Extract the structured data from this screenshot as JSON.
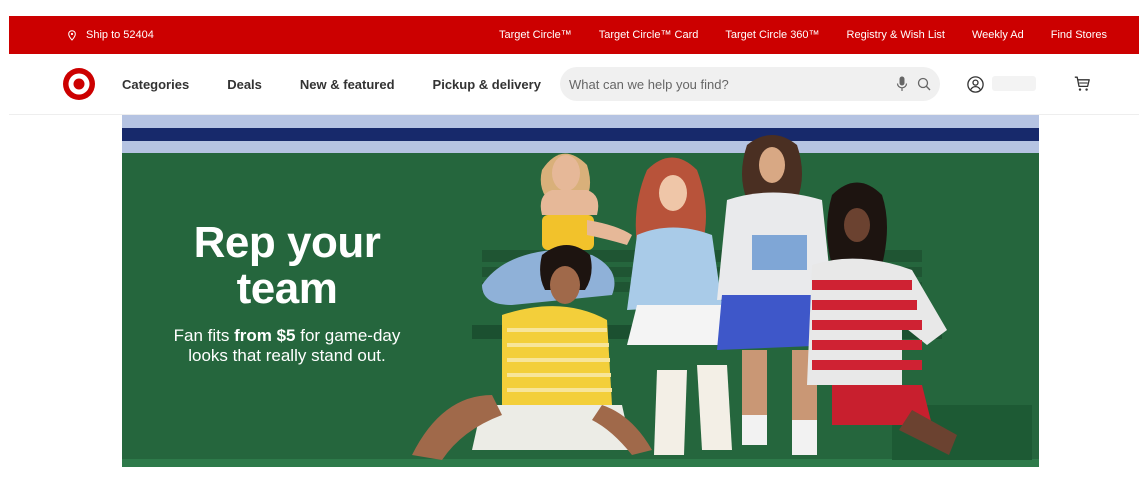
{
  "utility_bar": {
    "ship_to": "Ship to 52404",
    "links": [
      "Target Circle™",
      "Target Circle™ Card",
      "Target Circle 360™",
      "Registry & Wish List",
      "Weekly Ad",
      "Find Stores"
    ]
  },
  "header": {
    "nav": [
      "Categories",
      "Deals",
      "New & featured",
      "Pickup & delivery"
    ],
    "search_placeholder": "What can we help you find?"
  },
  "hero": {
    "title_line1": "Rep your",
    "title_line2": "team",
    "sub_pre": "Fan fits ",
    "sub_bold": "from $5",
    "sub_post": " for game-day looks that really stand out."
  },
  "colors": {
    "brand_red": "#cc0000",
    "hero_green": "#25663d",
    "hero_navy": "#17296b",
    "hero_light_blue": "#b5c3e2"
  },
  "icons": [
    "location-pin-icon",
    "target-logo",
    "microphone-icon",
    "search-icon",
    "account-icon",
    "cart-icon"
  ]
}
